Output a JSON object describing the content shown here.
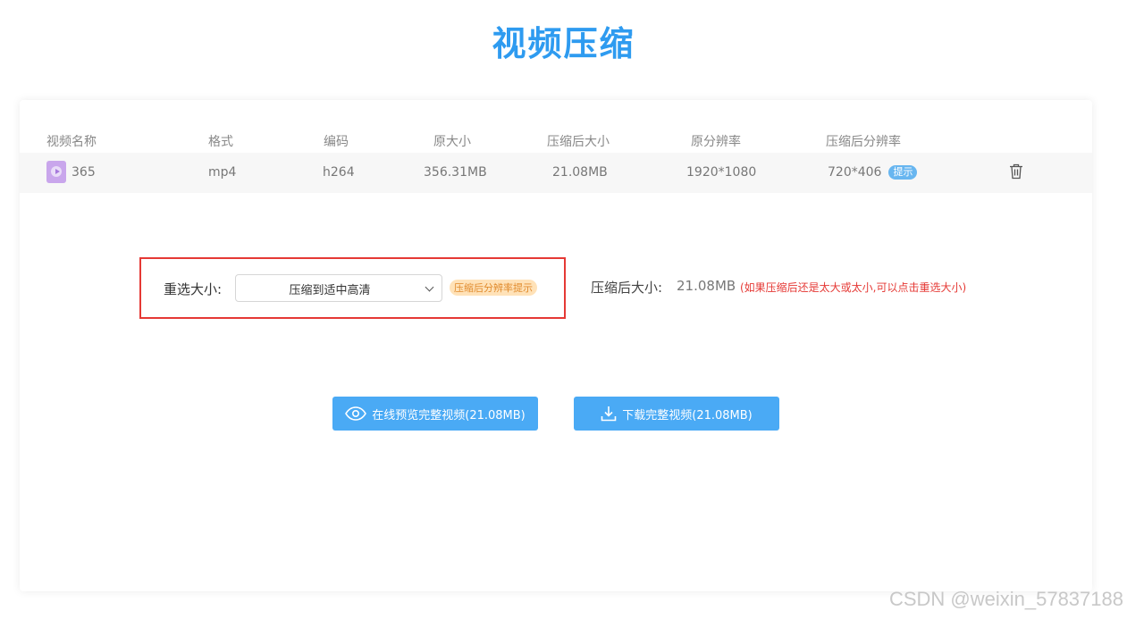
{
  "page": {
    "title": "视频压缩"
  },
  "table": {
    "headers": {
      "name": "视频名称",
      "format": "格式",
      "codec": "编码",
      "orig_size": "原大小",
      "comp_size": "压缩后大小",
      "orig_res": "原分辨率",
      "comp_res": "压缩后分辨率"
    },
    "row": {
      "name": "365",
      "format": "mp4",
      "codec": "h264",
      "orig_size": "356.31MB",
      "comp_size": "21.08MB",
      "orig_res": "1920*1080",
      "comp_res": "720*406",
      "tip_badge": "提示"
    }
  },
  "resize": {
    "label": "重选大小:",
    "selected": "压缩到适中高清",
    "res_tip": "压缩后分辨率提示"
  },
  "result": {
    "label": "压缩后大小:",
    "value": "21.08MB",
    "hint": "(如果压缩后还是太大或太小,可以点击重选大小)"
  },
  "buttons": {
    "preview": "在线预览完整视频(21.08MB)",
    "download": "下载完整视频(21.08MB)"
  },
  "watermark": "CSDN @weixin_57837188",
  "colors": {
    "accent": "#4aaaf5",
    "title": "#2e9bf0",
    "warning": "#e53935"
  }
}
